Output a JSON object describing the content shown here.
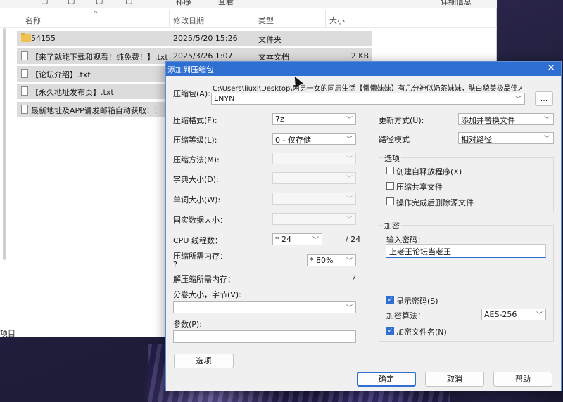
{
  "explorer": {
    "columns": {
      "name": "名称",
      "modified": "修改日期",
      "type": "类型",
      "size": "大小"
    },
    "toolbar": {
      "sort": "排序",
      "view": "查看",
      "details": "详细信息"
    },
    "files": [
      {
        "name": "54155",
        "modified": "2025/5/20 15:26",
        "type": "文件夹",
        "size": "",
        "icon": "folder-icon"
      },
      {
        "name": "【来了就能下载和观看！纯免费！】.txt",
        "modified": "2025/3/26 1:07",
        "type": "文本文档",
        "size": "2 KB",
        "icon": "text-file-icon"
      },
      {
        "name": "【论坛介绍】.txt",
        "modified": "",
        "type": "",
        "size": "",
        "icon": "text-file-icon"
      },
      {
        "name": "【永久地址发布页】.txt",
        "modified": "",
        "type": "",
        "size": "",
        "icon": "text-file-icon"
      },
      {
        "name": "最新地址及APP请发邮箱自动获取！！！...",
        "modified": "",
        "type": "",
        "size": "",
        "icon": "text-file-icon"
      }
    ],
    "status": "项目"
  },
  "dialog": {
    "title": "添加到压缩包",
    "archive_label": "压缩包(A):",
    "archive_path": "C:\\Users\\liuxi\\Desktop\\两男一女的同居生活【懒懒妹妹】有几分神似奶茶妹妹，肤白貌美极品佳人\\",
    "archive_name": "LNYN",
    "browse_label": "...",
    "left": {
      "format_label": "压缩格式(F):",
      "format_value": "7z",
      "level_label": "压缩等级(L):",
      "level_value": "0 - 仅存储",
      "method_label": "压缩方法(M):",
      "dict_label": "字典大小(D):",
      "word_label": "单词大小(W):",
      "solid_label": "固实数据大小：",
      "cpu_label": "CPU 线程数：",
      "cpu_value": "* 24",
      "cpu_total": "/ 24",
      "mem_label": "压缩所需内存：",
      "mem_q": "?",
      "mem_value": "* 80%",
      "decomp_label": "解压缩所需内存：",
      "decomp_value": "?",
      "split_label": "分卷大小，字节(V):",
      "params_label": "参数(P):",
      "options_button": "选项"
    },
    "right": {
      "update_label": "更新方式(U):",
      "update_value": "添加并替换文件",
      "path_label": "路径模式",
      "path_value": "相对路径",
      "options_title": "选项",
      "opt_sfx": "创建自释放程序(X)",
      "opt_sfx_checked": false,
      "opt_shared": "压缩共享文件",
      "opt_shared_checked": false,
      "opt_delete": "操作完成后删除源文件",
      "opt_delete_checked": false,
      "enc_title": "加密",
      "pw_label": "输入密码：",
      "pw_value": "上老王论坛当老王",
      "show_pw": "显示密码(S)",
      "show_pw_checked": true,
      "enc_method_label": "加密算法：",
      "enc_method_value": "AES-256",
      "enc_names": "加密文件名(N)",
      "enc_names_checked": true
    },
    "buttons": {
      "ok": "确定",
      "cancel": "取消",
      "help": "帮助"
    }
  }
}
